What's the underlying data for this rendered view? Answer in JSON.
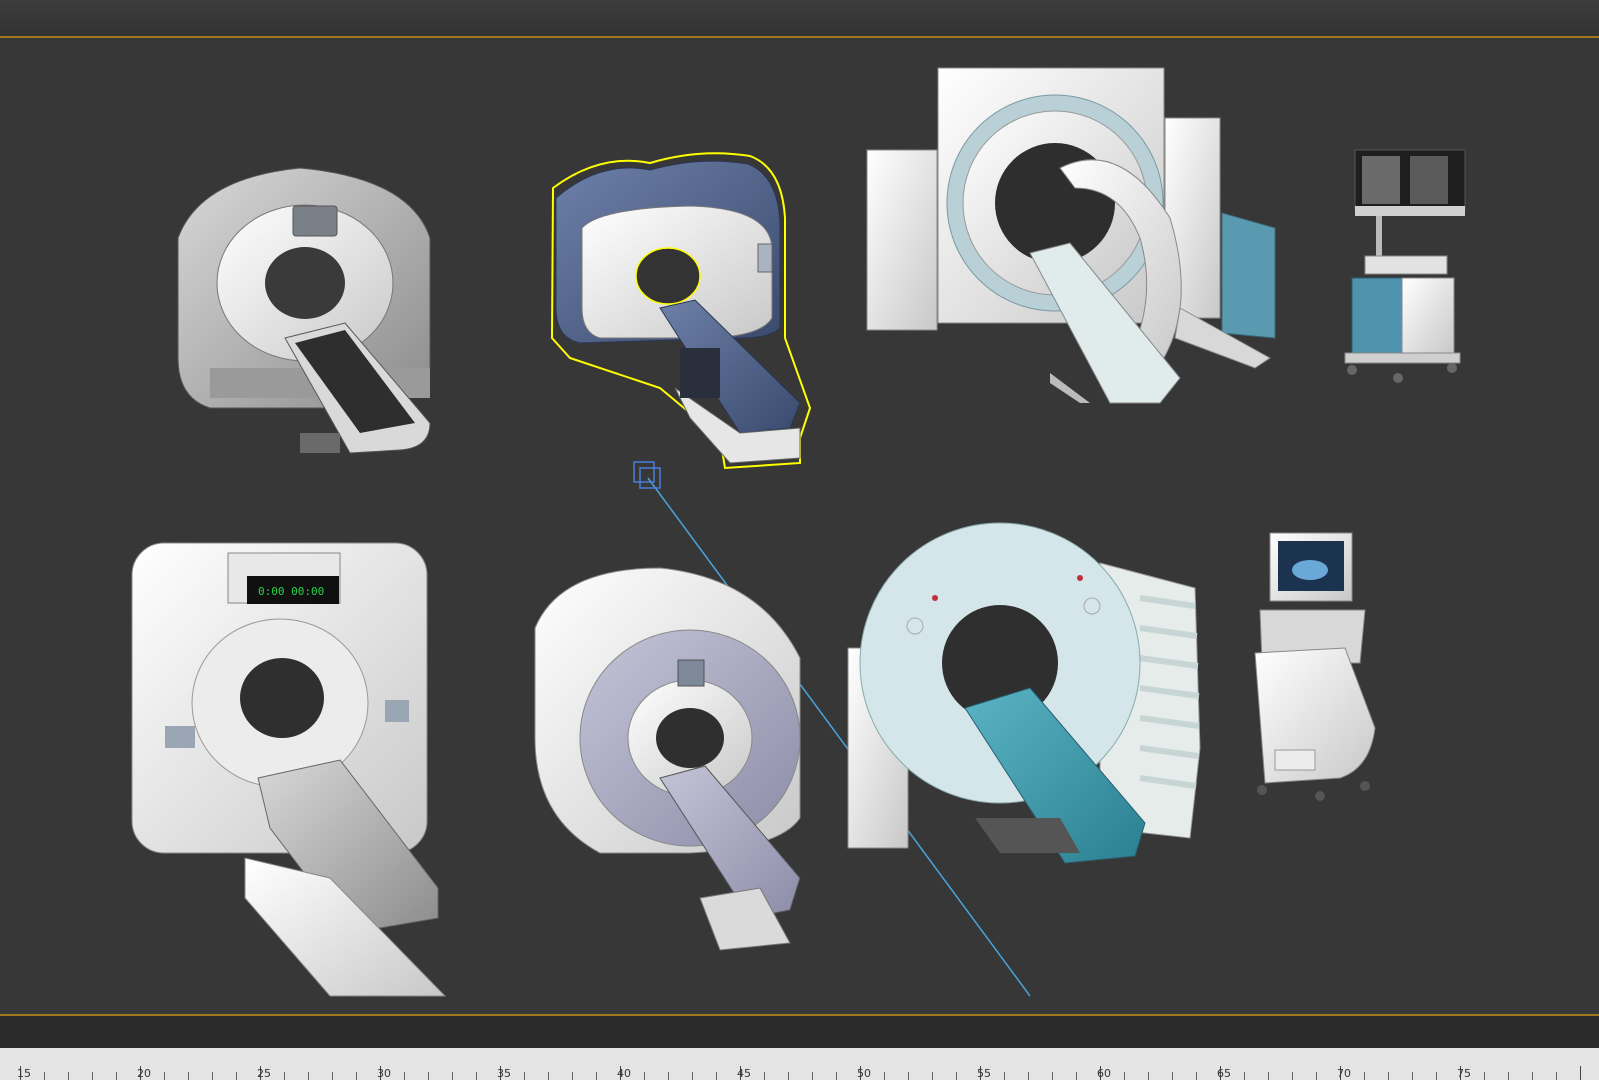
{
  "timeline": {
    "ruler_labels": [
      "15",
      "20",
      "25",
      "30",
      "35",
      "40",
      "45",
      "50",
      "55",
      "60",
      "65",
      "70",
      "75"
    ]
  },
  "viewport": {
    "selected_model": "ct-scanner-blue",
    "models": [
      "ct-scanner-gray",
      "ct-scanner-blue",
      "c-arm-ct-system",
      "xray-workstation-cart",
      "ct-scanner-square",
      "mri-scanner",
      "ct-scanner-teal",
      "ultrasound-cart"
    ],
    "accent_colors": {
      "selection": "#ffff00",
      "frame_border": "#a07a1a",
      "light_line": "#4aa3df"
    }
  }
}
